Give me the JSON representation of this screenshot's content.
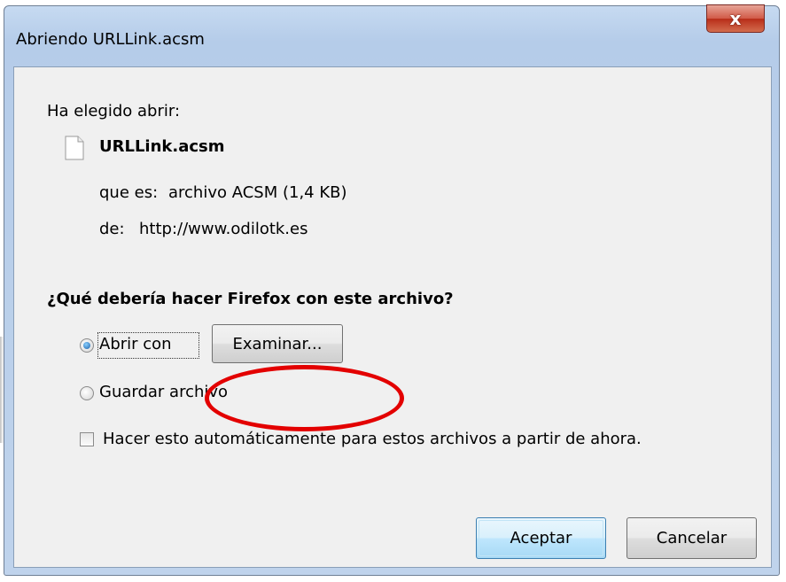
{
  "window": {
    "title": "Abriendo URLLink.acsm",
    "close_glyph": "x"
  },
  "file": {
    "chosen_label": "Ha elegido abrir:",
    "icon": "file-icon",
    "name": "URLLink.acsm",
    "type_label": "que es:",
    "type_value": "archivo ACSM (1,4 KB)",
    "from_label": "de:",
    "from_value": "http://www.odilotk.es"
  },
  "action": {
    "question": "¿Qué debería hacer Firefox con este archivo?",
    "open_with_label": "Abrir con",
    "open_with_selected": true,
    "browse_label": "Examinar...",
    "save_label": "Guardar archivo",
    "save_selected": false,
    "auto_label": "Hacer esto automáticamente para estos archivos a partir de ahora.",
    "auto_checked": false
  },
  "buttons": {
    "ok_label": "Aceptar",
    "cancel_label": "Cancelar"
  },
  "colors": {
    "highlight": "#e30000",
    "close_button": "#c7432f",
    "default_button_border": "#3c7fb1"
  }
}
